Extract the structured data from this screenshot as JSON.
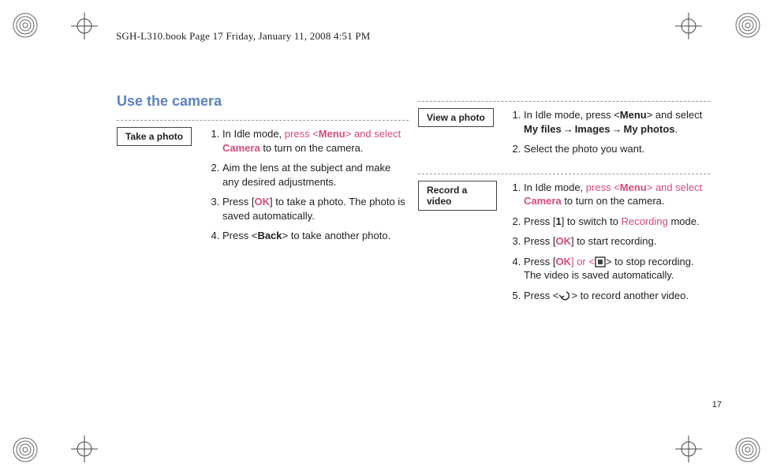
{
  "header": "SGH-L310.book  Page 17  Friday, January 11, 2008  4:51 PM",
  "page_number": "17",
  "section_title": "Use the camera",
  "take_photo": {
    "label": "Take a photo",
    "step1_a": "In Idle mode, ",
    "step1_b": "press <",
    "step1_menu": "Menu",
    "step1_c": "> and select ",
    "step1_camera": "Camera",
    "step1_d": " to turn on the camera.",
    "step2": "Aim the lens at the subject and make any desired adjustments.",
    "step3_a": "Press [",
    "step3_ok": "OK",
    "step3_b": "] to take a photo. The photo is saved automatically.",
    "step4_a": "Press <",
    "step4_back": "Back",
    "step4_b": "> to take another photo."
  },
  "view_photo": {
    "label": "View a photo",
    "step1_a": "In Idle mode, press <",
    "step1_menu": "Menu",
    "step1_b": "> and select ",
    "step1_myfiles": "My files",
    "step1_arrow1": " → ",
    "step1_images": "Images",
    "step1_arrow2": " → ",
    "step1_myphotos": "My photos",
    "step1_c": ".",
    "step2": "Select the photo you want."
  },
  "record_video": {
    "label": "Record a video",
    "step1_a": "In Idle mode, ",
    "step1_b": "press <",
    "step1_menu": "Menu",
    "step1_c": "> and select ",
    "step1_camera": "Camera",
    "step1_d": " to turn on the camera.",
    "step2_a": "Press [",
    "step2_one": "1",
    "step2_b": "] to switch to ",
    "step2_rec": "Recording",
    "step2_c": " mode.",
    "step3_a": "Press [",
    "step3_ok": "OK",
    "step3_b": "] to start recording.",
    "step4_a": "Press [",
    "step4_ok": "OK",
    "step4_b": "] or <",
    "step4_c": "> to stop recording. The video is saved automatically.",
    "step5_a": "Press <",
    "step5_b": "> to record another video."
  }
}
